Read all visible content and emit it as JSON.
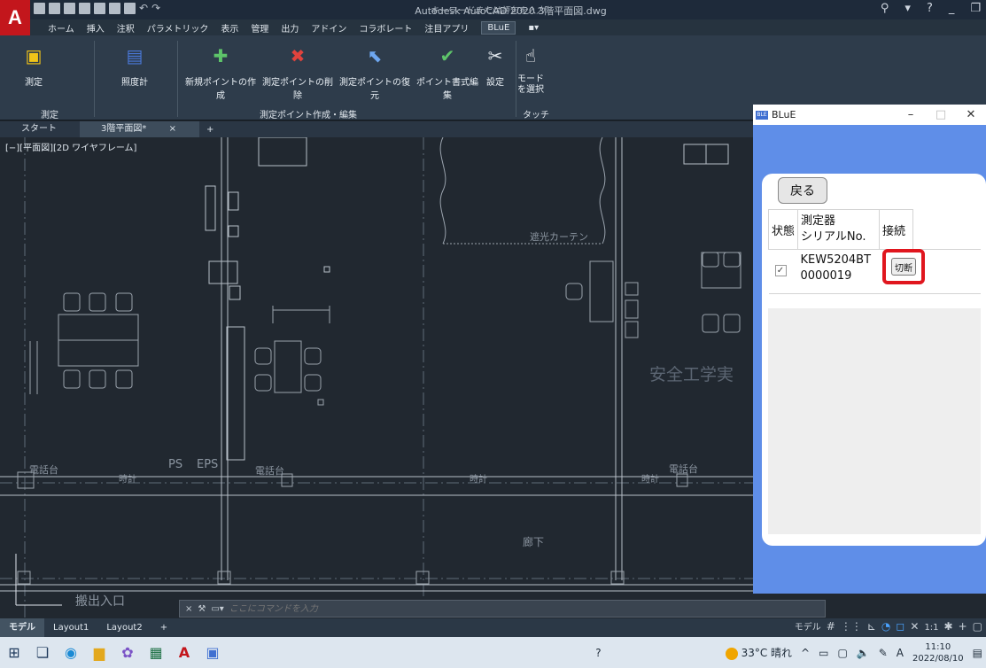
{
  "app": {
    "title": "Autodesk AutoCAD 2020  3階平面図.dwg",
    "search_placeholder": "キーワードまたは語句を入力"
  },
  "ribbon_tabs": [
    "ホーム",
    "挿入",
    "注釈",
    "パラメトリック",
    "表示",
    "管理",
    "出力",
    "アドイン",
    "コラボレート",
    "注目アプリ",
    "BLuE"
  ],
  "ribbon": {
    "buttons": [
      {
        "label": "測定",
        "icon": "measure-icon"
      },
      {
        "label": "照度計",
        "icon": "lux-meter-icon"
      },
      {
        "label": "新規ポイントの作成",
        "icon": "new-point-icon"
      },
      {
        "label": "測定ポイントの削除",
        "icon": "delete-point-icon"
      },
      {
        "label": "測定ポイントの復元",
        "icon": "restore-point-icon"
      },
      {
        "label": "ポイント書式編集",
        "icon": "point-format-icon"
      },
      {
        "label": "設定",
        "icon": "settings-icon"
      },
      {
        "label": "モードを選択",
        "icon": "touch-mode-icon"
      }
    ],
    "panels": [
      "測定",
      "測定ポイント作成・編集",
      "タッチ"
    ]
  },
  "file_tabs": [
    "スタート",
    "3階平面図*"
  ],
  "viewport_label": "[−][平面図][2D ワイヤフレーム]",
  "drawing_texts": {
    "curtain": "遮光カーテン",
    "room": "安全工学実",
    "corridor": "廊下",
    "phone1": "電話台",
    "phone2": "電話台",
    "phone3": "電話台",
    "clock1": "時計",
    "clock2": "時計",
    "clock3": "時計",
    "ps": "PS",
    "eps": "EPS",
    "carry": "搬出入口"
  },
  "command_line": {
    "placeholder": "ここにコマンドを入力"
  },
  "status_bar": {
    "tabs": [
      "モデル",
      "Layout1",
      "Layout2"
    ],
    "model_label": "モデル",
    "scale": "1:1"
  },
  "blue_window": {
    "title": "BLuE",
    "back_label": "戻る",
    "headers": {
      "status": "状態",
      "device": "測定器\nシリアルNo.",
      "connect": "接続"
    },
    "rows": [
      {
        "checked": true,
        "serial": "KEW5204BT\n0000019",
        "action": "切断"
      }
    ]
  },
  "taskbar": {
    "weather": "33°C 晴れ",
    "time": "11:10",
    "date": "2022/08/10"
  },
  "colors": {
    "accent_red": "#e0161e",
    "blue_bg": "#5f8ee8",
    "cad_bg": "#212830"
  }
}
